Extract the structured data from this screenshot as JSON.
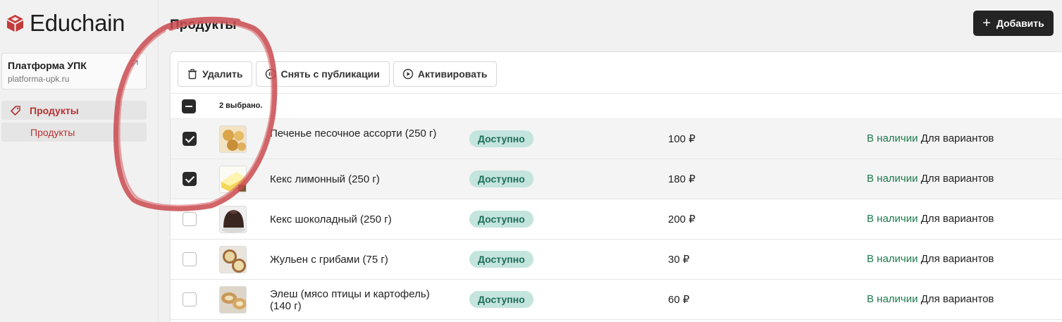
{
  "brand": {
    "name": "Educhain",
    "accent": "#b83232"
  },
  "store": {
    "name": "Платформа УПК",
    "url": "platforma-upk.ru"
  },
  "sidebar": {
    "items": [
      {
        "label": "Продукты",
        "icon": "tag-icon"
      },
      {
        "label": "Продукты"
      }
    ]
  },
  "header": {
    "title": "Продукты",
    "add_label": "Добавить"
  },
  "toolbar": {
    "delete_label": "Удалить",
    "unpublish_label": "Снять с публикации",
    "activate_label": "Активировать"
  },
  "selection": {
    "text": "2 выбрано."
  },
  "products": [
    {
      "name": "Печенье песочное ассорти (250 г)",
      "status": "Доступно",
      "price": "100 ₽",
      "stock": "В наличии",
      "variants": "Для вариантов",
      "checked": true
    },
    {
      "name": "Кекс лимонный (250 г)",
      "status": "Доступно",
      "price": "180 ₽",
      "stock": "В наличии",
      "variants": "Для вариантов",
      "checked": true
    },
    {
      "name": "Кекс шоколадный (250 г)",
      "status": "Доступно",
      "price": "200 ₽",
      "stock": "В наличии",
      "variants": "Для вариантов",
      "checked": false
    },
    {
      "name": "Жульен с грибами (75 г)",
      "status": "Доступно",
      "price": "30 ₽",
      "stock": "В наличии",
      "variants": "Для вариантов",
      "checked": false
    },
    {
      "name": "Элеш (мясо птицы и картофель) (140 г)",
      "status": "Доступно",
      "price": "60 ₽",
      "stock": "В наличии",
      "variants": "Для вариантов",
      "checked": false
    }
  ]
}
